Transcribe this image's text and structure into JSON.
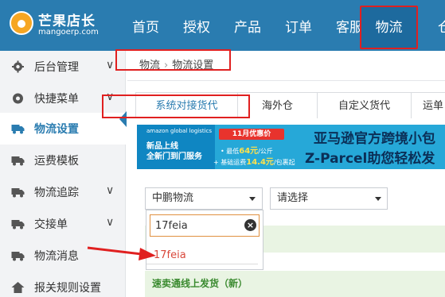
{
  "header": {
    "logo": {
      "name": "芒果店长",
      "url": "mangoerp.com",
      "icon": "mango-logo-icon"
    },
    "nav": [
      "首页",
      "授权",
      "产品",
      "订单",
      "客服"
    ],
    "nav_active": "物流",
    "nav_partial": "仓"
  },
  "sidebar": {
    "items": [
      {
        "label": "后台管理",
        "icon": "gear-icon",
        "chevron": "∨"
      },
      {
        "label": "快捷菜单",
        "icon": "settings-icon",
        "chevron": "∨"
      },
      {
        "label": "物流设置",
        "icon": "truck-icon",
        "chevron": ""
      },
      {
        "label": "运费模板",
        "icon": "truck-icon",
        "chevron": ""
      },
      {
        "label": "物流追踪",
        "icon": "truck-icon",
        "chevron": "∨"
      },
      {
        "label": "交接单",
        "icon": "truck-icon",
        "chevron": "∨"
      },
      {
        "label": "物流消息",
        "icon": "truck-icon",
        "chevron": ""
      },
      {
        "label": "报关规则设置",
        "icon": "house-icon",
        "chevron": ""
      }
    ],
    "active_index": 2
  },
  "breadcrumb": {
    "root": "物流",
    "separator": "›",
    "current": "物流设置"
  },
  "tabs": [
    "系统对接货代",
    "海外仓",
    "自定义货代",
    "运单"
  ],
  "banner": {
    "brand": "amazon global logistics",
    "new": "新品上线",
    "service": "全新门到门服务",
    "promo": "11月优惠价",
    "low_prefix": "• 最低",
    "low_price": "64元",
    "low_suffix": "/公斤",
    "ship_prefix": "+ 基础运费",
    "ship_price": "14.4元",
    "ship_suffix": "/包裹起",
    "title1": "亚马逊官方跨境小包",
    "title2": "Z-Parcel助您轻松发货"
  },
  "filters": {
    "provider": "中鹏物流",
    "second": "请选择",
    "search_value": "17feia",
    "option": "17feia"
  },
  "rows": {
    "row2_label": "速卖通线上发货（新）"
  },
  "colors": {
    "primary": "#2a7cb0",
    "annotation": "#e02020",
    "green_bg": "#e9f4e3"
  }
}
